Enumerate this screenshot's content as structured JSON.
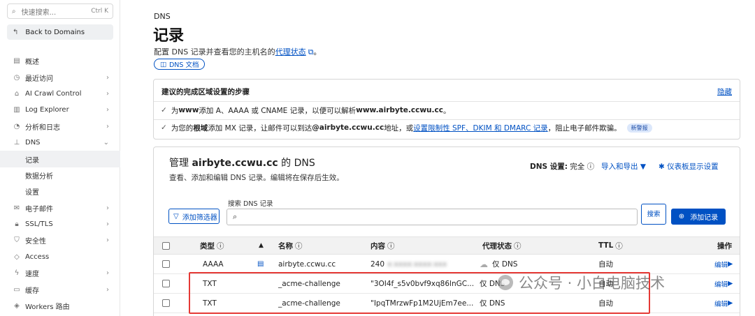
{
  "sidebar": {
    "search_placeholder": "快速搜索...",
    "search_shortcut": "Ctrl K",
    "back_label": "Back to Domains",
    "items": [
      {
        "label": "概述",
        "icon": "file-icon",
        "chevron": false
      },
      {
        "label": "最近访问",
        "icon": "clock-icon",
        "chevron": true
      },
      {
        "label": "AI Crawl Control",
        "icon": "robot-icon",
        "chevron": true
      },
      {
        "label": "Log Explorer",
        "icon": "log-icon",
        "chevron": true
      },
      {
        "label": "分析和日志",
        "icon": "chart-icon",
        "chevron": true
      },
      {
        "label": "DNS",
        "icon": "network-icon",
        "chevron": true,
        "expanded": true
      },
      {
        "label": "记录",
        "sub": true,
        "active": true
      },
      {
        "label": "数据分析",
        "sub": true
      },
      {
        "label": "设置",
        "sub": true
      },
      {
        "label": "电子邮件",
        "icon": "mail-icon",
        "chevron": true
      },
      {
        "label": "SSL/TLS",
        "icon": "lock-icon",
        "chevron": true
      },
      {
        "label": "安全性",
        "icon": "shield-icon",
        "chevron": true
      },
      {
        "label": "Access",
        "icon": "access-icon",
        "chevron": false
      },
      {
        "label": "速度",
        "icon": "bolt-icon",
        "chevron": true
      },
      {
        "label": "缓存",
        "icon": "cache-icon",
        "chevron": true
      },
      {
        "label": "Workers 路由",
        "icon": "workers-icon",
        "chevron": false
      }
    ]
  },
  "header": {
    "breadcrumb": "DNS",
    "title": "记录",
    "desc_prefix": "配置 DNS 记录并查看您的主机名的",
    "desc_link": "代理状态",
    "desc_suffix": "。",
    "doc_link": "DNS 文档"
  },
  "steps": {
    "title": "建议的完成区域设置的步骤",
    "hide": "隐藏",
    "row1": {
      "p1": "为 ",
      "b1": "www",
      "p2": " 添加 A、AAAA 或 CNAME 记录，以便可以解析 ",
      "b2": "www.airbyte.ccwu.cc",
      "p3": "。"
    },
    "row2": {
      "p1": "为您的",
      "b1": "根域",
      "p2": "添加 MX 记录，让邮件可以到达 ",
      "b2": "@airbyte.ccwu.cc",
      "p3": " 地址，或",
      "link": "设置限制性 SPF、DKIM 和 DMARC 记录",
      "p4": "，阻止电子邮件欺骗。",
      "badge": "新警报"
    }
  },
  "manage": {
    "title_prefix": "管理 ",
    "domain": "airbyte.ccwu.cc",
    "title_suffix": " 的 DNS",
    "subtitle": "查看、添加和编辑 DNS 记录。编辑将在保存后生效。",
    "dns_setting_label": "DNS 设置:",
    "dns_setting_value": "完全",
    "export_label": "导入和导出",
    "dashboard_label": "仪表板显示设置",
    "filter_label": "添加筛选器",
    "search_label": "搜索 DNS 记录",
    "search_btn": "搜索",
    "add_btn": "添加记录"
  },
  "table": {
    "headers": {
      "type": "类型",
      "name": "名称",
      "content": "内容",
      "proxy": "代理状态",
      "ttl": "TTL",
      "actions": "操作"
    },
    "rows": [
      {
        "type": "AAAA",
        "name": "airbyte.ccwu.cc",
        "content": "240",
        "content_blurred": "x:xxxx:xxxx:xxx",
        "proxy": "仅 DNS",
        "ttl": "自动",
        "edit": "编辑"
      },
      {
        "type": "TXT",
        "name": "_acme-challenge",
        "content": "\"3OI4f_s5v0bvf9xq86lnGC...",
        "proxy": "仅 DNS",
        "ttl": "自动",
        "edit": "编辑"
      },
      {
        "type": "TXT",
        "name": "_acme-challenge",
        "content": "\"IpqTMrzwFp1M2UjEm7ee...",
        "proxy": "仅 DNS",
        "ttl": "自动",
        "edit": "编辑"
      }
    ]
  },
  "watermark": "公众号 · 小白电脑技术",
  "colors": {
    "accent": "#0051c3",
    "highlight": "#e53935"
  }
}
